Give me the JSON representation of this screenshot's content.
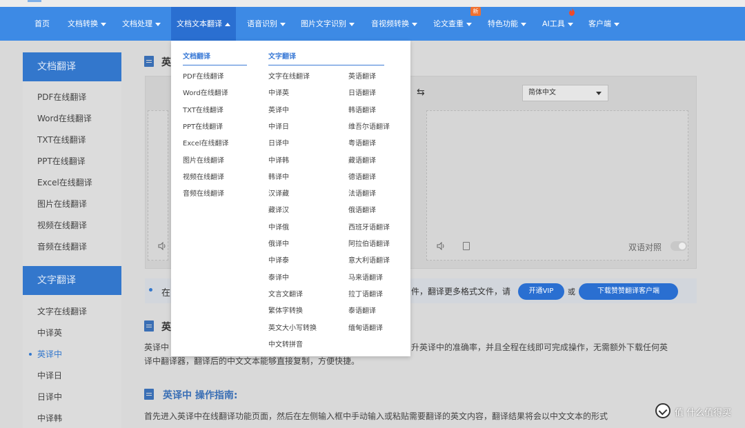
{
  "nav": {
    "home": "首页",
    "doc_convert": "文档转换",
    "doc_process": "文档处理",
    "doc_translate": "文档文本翻译",
    "speech": "语音识别",
    "image_ocr": "图片文字识别",
    "av_convert": "音视频转换",
    "paper_check": "论文查重",
    "paper_check_badge": "新",
    "features": "特色功能",
    "ai_tools": "AI工具",
    "client": "客户端"
  },
  "sidebar": {
    "doc_header": "文档翻译",
    "doc_items": [
      "PDF在线翻译",
      "Word在线翻译",
      "TXT在线翻译",
      "PPT在线翻译",
      "Excel在线翻译",
      "图片在线翻译",
      "视频在线翻译",
      "音频在线翻译"
    ],
    "text_header": "文字翻译",
    "text_items": [
      "文字在线翻译",
      "中译英",
      "英译中",
      "中译日",
      "日译中",
      "中译韩"
    ],
    "active_item": "英译中"
  },
  "content": {
    "top_title_partial": "英",
    "lang_select": "简体中文",
    "bilingual": "双语对照",
    "notice_start": "在",
    "notice_text": "件，翻译更多格式文件，请",
    "vip_button": "开通VIP",
    "or_text": "或",
    "download_button": "下载赞赞翻译客户端",
    "intro_title_partial": "英",
    "intro_line1_left": "英译中",
    "intro_line1_right": "升英译中的准确率，并且全程在线即可完成操作，无需额外下载任何英",
    "intro_line2": "译中翻译器，翻译后的中文文本能够直接复制，方便快捷。",
    "guide_title": "英译中 操作指南:",
    "guide_text": "首先进入英译中在线翻译功能页面，然后在左侧输入框中手动输入或粘贴需要翻译的英文内容，翻译结果将会以中文文本的形式"
  },
  "dropdown": {
    "col1_header": "文档翻译",
    "col1_items": [
      "PDF在线翻译",
      "Word在线翻译",
      "TXT在线翻译",
      "PPT在线翻译",
      "Excel在线翻译",
      "图片在线翻译",
      "视频在线翻译",
      "音频在线翻译"
    ],
    "col2_header": "文字翻译",
    "col2_items": [
      "文字在线翻译",
      "中译英",
      "英译中",
      "中译日",
      "日译中",
      "中译韩",
      "韩译中",
      "汉译藏",
      "藏译汉",
      "中译俄",
      "俄译中",
      "中译泰",
      "泰译中",
      "文言文翻译",
      "繁体字转换",
      "英文大小写转换",
      "中文转拼音"
    ],
    "col3_items": [
      "英语翻译",
      "日语翻译",
      "韩语翻译",
      "维吾尔语翻译",
      "粤语翻译",
      "藏语翻译",
      "德语翻译",
      "法语翻译",
      "俄语翻译",
      "西班牙语翻译",
      "阿拉伯语翻译",
      "意大利语翻译",
      "马来语翻译",
      "拉丁语翻译",
      "泰语翻译",
      "缅甸语翻译"
    ]
  },
  "watermark": {
    "text": "值 什么值得买"
  },
  "colors": {
    "nav_bg": "#3d8ae5",
    "nav_active": "#2a6fd1",
    "sidebar_head": "#3377cc",
    "accent": "#3a7ad6",
    "badge": "#f07030"
  }
}
